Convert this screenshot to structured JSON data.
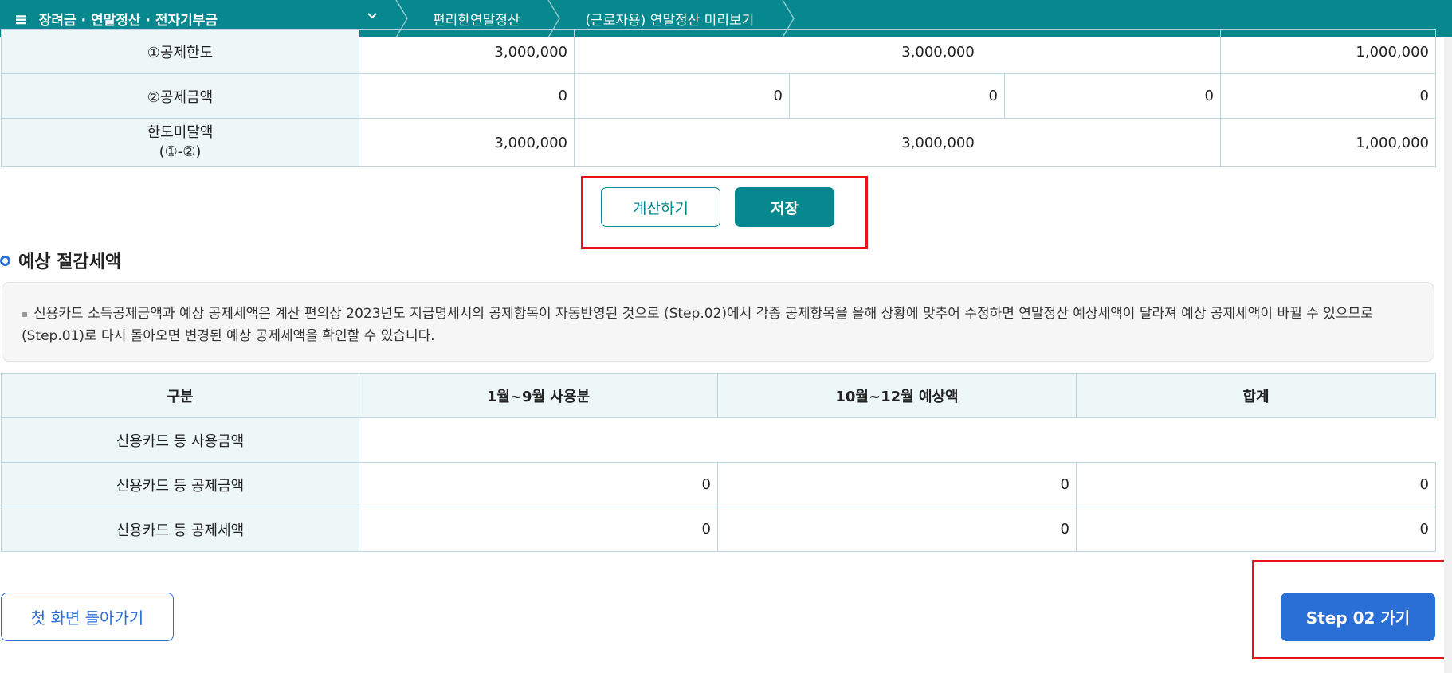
{
  "nav": {
    "menu_label": "장려금 · 연말정산 · 전자기부금",
    "crumbs": [
      "편리한연말정산",
      "(근로자용) 연말정산 미리보기"
    ]
  },
  "limit_table": {
    "rows": [
      {
        "label": "①공제한도",
        "c1": "3,000,000",
        "c2": "3,000,000",
        "c3": "1,000,000"
      },
      {
        "label": "②공제금액",
        "c1": "0",
        "d1": "0",
        "d2": "0",
        "d3": "0",
        "c3": "0"
      },
      {
        "label": "한도미달액",
        "label2": "(①-②)",
        "c1": "3,000,000",
        "c2": "3,000,000",
        "c3": "1,000,000"
      }
    ]
  },
  "buttons": {
    "calc": "계산하기",
    "save": "저장",
    "home": "첫 화면 돌아가기",
    "step": "Step 02 가기"
  },
  "section": {
    "title": "예상 절감세액",
    "notice_line1": "신용카드 소득공제금액과 예상 공제세액은 계산 편의상 2023년도 지급명세서의 공제항목이 자동반영된 것으로 (Step.02)에서 각종 공제항목을 올해 상황에 맞추어 수정하면 연말정산 예상세액이 달라져 예상 공제세액이 바뀔 수 있으므로",
    "notice_line2": "(Step.01)로 다시 돌아오면 변경된 예상 공제세액을 확인할 수 있습니다."
  },
  "est_table": {
    "headers": [
      "구분",
      "1월~9월 사용분",
      "10월~12월 예상액",
      "합계"
    ],
    "rows": [
      {
        "label": "신용카드 등 사용금액",
        "v1": "",
        "v2": "",
        "v3": ""
      },
      {
        "label": "신용카드 등 공제금액",
        "v1": "0",
        "v2": "0",
        "v3": "0"
      },
      {
        "label": "신용카드 등 공제세액",
        "v1": "0",
        "v2": "0",
        "v3": "0"
      }
    ]
  },
  "colors": {
    "teal": "#07888f",
    "blue": "#2a6fd6",
    "highlight": "#e8121a"
  }
}
